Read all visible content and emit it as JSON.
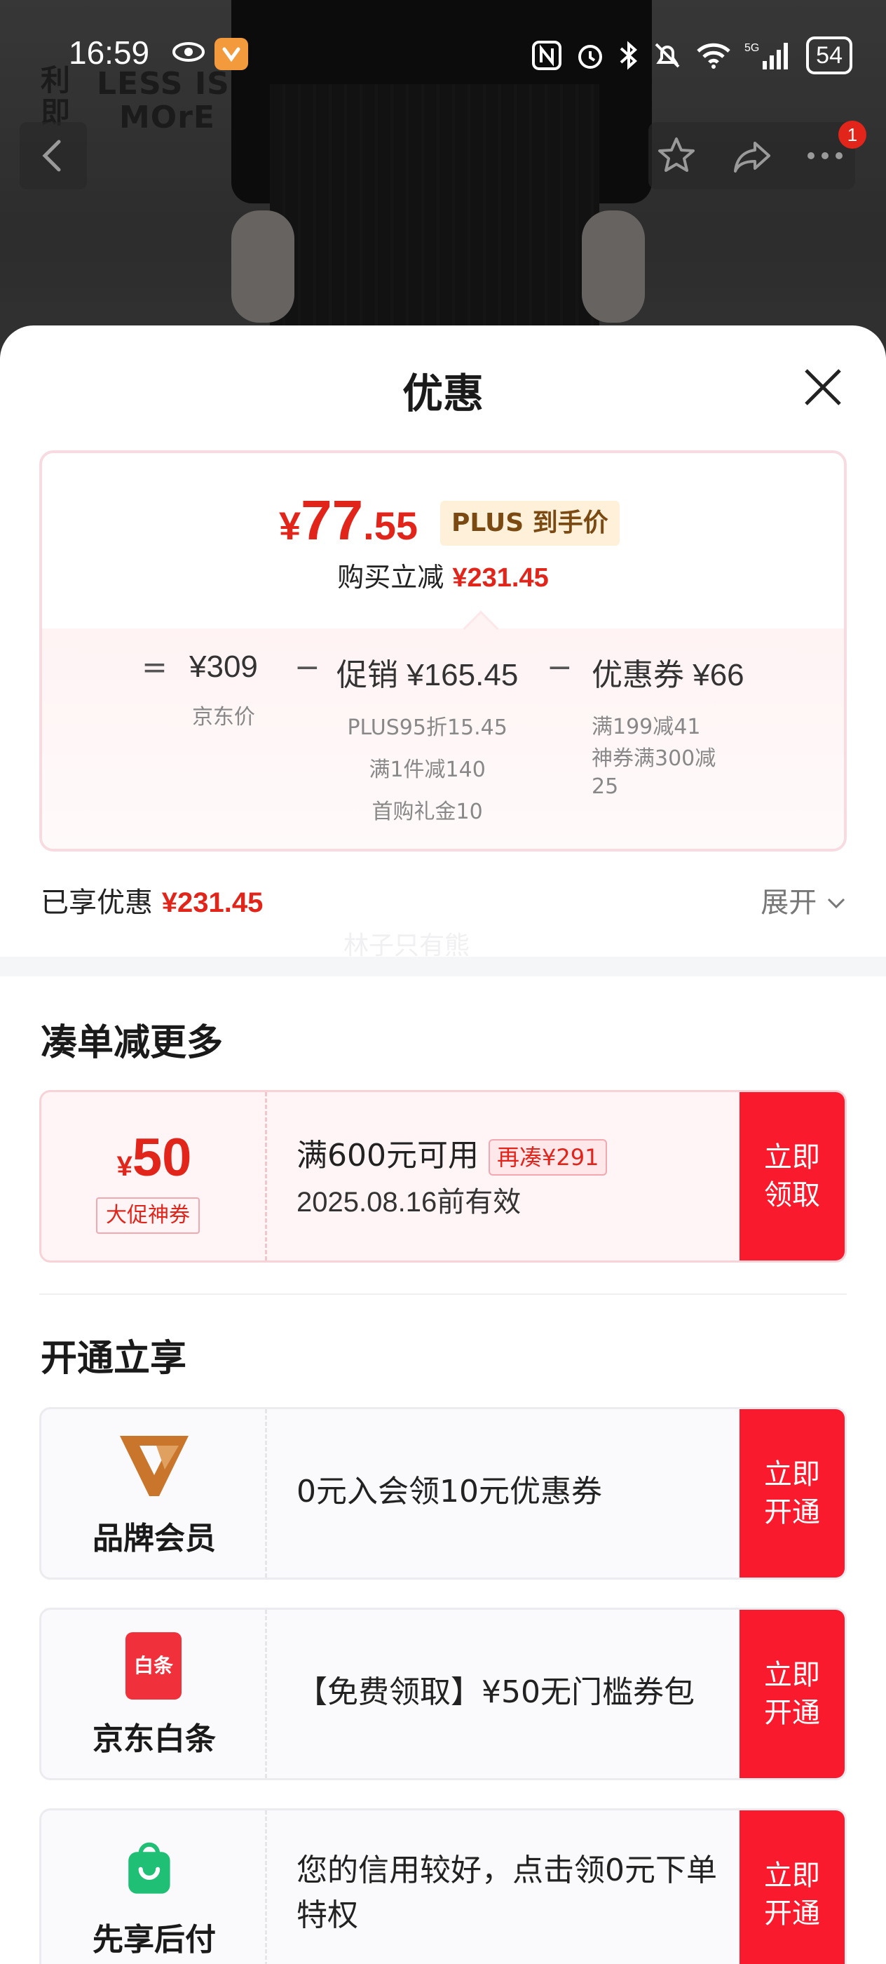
{
  "status_bar": {
    "time": "16:59",
    "battery": "54"
  },
  "brand": {
    "logo_cn": "利即",
    "logo_en_1": "LESS IS",
    "logo_en_2": "MOrE"
  },
  "nav": {
    "badge_count": "1"
  },
  "sheet": {
    "title": "优惠",
    "price_card": {
      "currency": "¥",
      "final_int": "77",
      "final_dec": ".55",
      "plus_tag": "PLUS 到手价",
      "reduce_label": "购买立减",
      "reduce_amount": "¥231.45",
      "formula": {
        "eq": "=",
        "jd_price": "¥309",
        "jd_price_label": "京东价",
        "minus1": "−",
        "promo_label": "促销",
        "promo_amount": "¥165.45",
        "promo_details": [
          "PLUS95折15.45",
          "满1件减140",
          "首购礼金10"
        ],
        "minus2": "−",
        "coupon_label": "优惠券",
        "coupon_amount": "¥66",
        "coupon_details": [
          "满199减41",
          "神券满300减",
          "25"
        ]
      }
    },
    "enjoyed_label": "已享优惠",
    "enjoyed_amount": "¥231.45",
    "expand_label": "展开",
    "watermark": "林子只有熊",
    "section_more": {
      "title": "凑单减更多",
      "coupon": {
        "currency": "¥",
        "amount": "50",
        "tag": "大促神券",
        "condition": "满600元可用",
        "more_tag": "再凑¥291",
        "valid_date": "2025.08.16",
        "valid_suffix": "前有效",
        "button_line1": "立即",
        "button_line2": "领取"
      }
    },
    "section_open": {
      "title": "开通立享",
      "rows": [
        {
          "name": "品牌会员",
          "desc": "0元入会领10元优惠券",
          "button_line1": "立即",
          "button_line2": "开通"
        },
        {
          "name": "京东白条",
          "logo_text": "白条",
          "desc": "【免费领取】¥50无门槛券包",
          "button_line1": "立即",
          "button_line2": "开通"
        },
        {
          "name": "先享后付",
          "desc": "您的信用较好，点击领0元下单特权",
          "button_line1": "立即",
          "button_line2": "开通"
        }
      ]
    }
  },
  "colors": {
    "accent_red": "#e1251b",
    "button_red": "#fa1a2e",
    "plus_gold": "#7a4a12",
    "member_orange": "#c9762c",
    "baitiao_red": "#f0313c",
    "green": "#1fbf75"
  },
  "icons": [
    "eye-icon",
    "app-icon",
    "nfc-icon",
    "alarm-icon",
    "bluetooth-icon",
    "mute-icon",
    "wifi-icon",
    "signal-icon",
    "back-icon",
    "star-icon",
    "share-icon",
    "more-icon",
    "close-icon",
    "chevron-down-icon"
  ]
}
